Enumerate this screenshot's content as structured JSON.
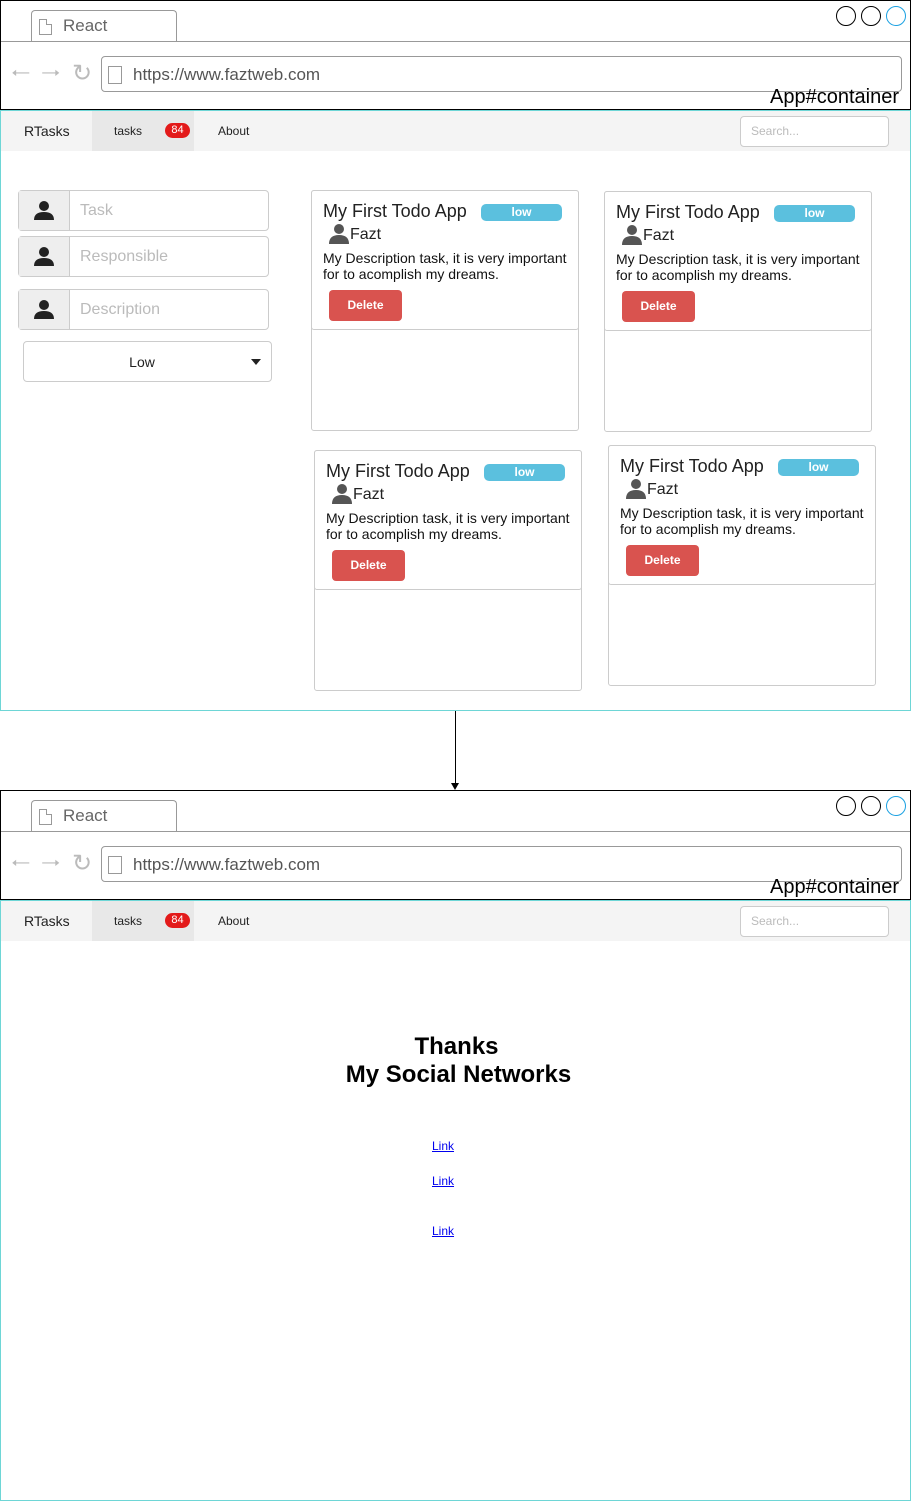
{
  "browser": {
    "tab_title": "React",
    "url": "https://www.faztweb.com",
    "container_label": "App#container"
  },
  "navbar": {
    "brand": "RTasks",
    "tasks_label": "tasks",
    "tasks_count": "84",
    "about_label": "About",
    "search_placeholder": "Search..."
  },
  "form": {
    "task_placeholder": "Task",
    "responsible_placeholder": "Responsible",
    "description_placeholder": "Description",
    "priority_selected": "Low"
  },
  "cards": [
    {
      "title": "My First Todo App",
      "priority": "low",
      "responsible": "Fazt",
      "description": "My Description task, it is very important for to acomplish my dreams.",
      "delete_label": "Delete"
    },
    {
      "title": "My First Todo App",
      "priority": "low",
      "responsible": "Fazt",
      "description": "My Description task, it is very important for to acomplish my dreams.",
      "delete_label": "Delete"
    },
    {
      "title": "My First Todo App",
      "priority": "low",
      "responsible": "Fazt",
      "description": "My Description task, it is very important for to acomplish my dreams.",
      "delete_label": "Delete"
    },
    {
      "title": "My First Todo App",
      "priority": "low",
      "responsible": "Fazt",
      "description": "My Description task, it is very important for to acomplish my dreams.",
      "delete_label": "Delete"
    }
  ],
  "about": {
    "heading_line1": "Thanks",
    "heading_line2": "My Social Networks",
    "links": [
      "Link",
      "Link",
      "Link"
    ]
  }
}
